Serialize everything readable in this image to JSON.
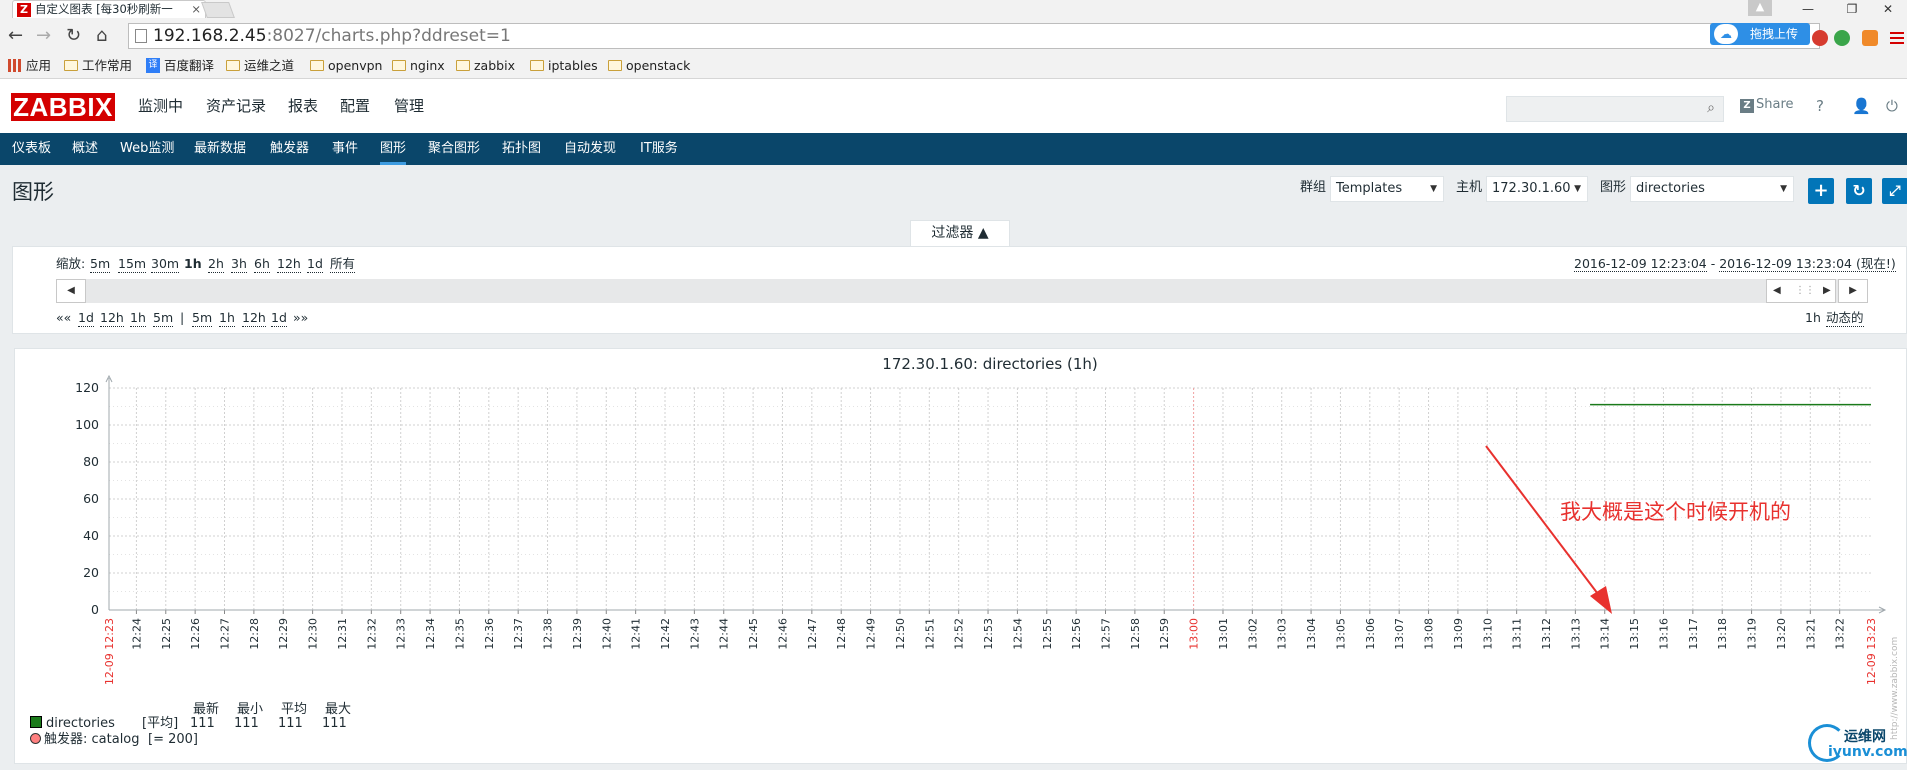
{
  "browser": {
    "tab_title": "自定义图表 [每30秒刷新一",
    "url_host": "192.168.2.45",
    "url_rest": ":8027/charts.php?ddreset=1",
    "upload_label": "拖拽上传",
    "bookmarks": [
      "应用",
      "工作常用",
      "百度翻译",
      "运维之道",
      "openvpn",
      "nginx",
      "zabbix",
      "iptables",
      "openstack"
    ]
  },
  "zabbix": {
    "logo": "ZABBIX",
    "main_menu": [
      "监测中",
      "资产记录",
      "报表",
      "配置",
      "管理"
    ],
    "share_label": "Share",
    "sub_menu": [
      "仪表板",
      "概述",
      "Web监测",
      "最新数据",
      "触发器",
      "事件",
      "图形",
      "聚合图形",
      "拓扑图",
      "自动发现",
      "IT服务"
    ],
    "active_sub": "图形"
  },
  "page": {
    "title": "图形",
    "group_label": "群组",
    "group_value": "Templates",
    "host_label": "主机",
    "host_value": "172.30.1.60",
    "graph_label": "图形",
    "graph_value": "directories"
  },
  "filter": {
    "tab_label": "过滤器 ▲",
    "zoom_label": "缩放:",
    "zoom_options": [
      "5m",
      "15m",
      "30m",
      "1h",
      "2h",
      "3h",
      "6h",
      "12h",
      "1d",
      "所有"
    ],
    "zoom_active": "1h",
    "time_range_from": "2016-12-09 12:23:04",
    "time_range_sep": " - ",
    "time_range_to": "2016-12-09 13:23:04 (现在!)",
    "back_options": [
      "««",
      "1d",
      "12h",
      "1h",
      "5m"
    ],
    "fwd_options": [
      "5m",
      "1h",
      "12h",
      "1d",
      "»»"
    ],
    "period": "1h",
    "dynamic_label": "动态的"
  },
  "colors": {
    "series": "#1a7a1a",
    "trigger": "#ff8080",
    "red_axis": "#e8312e",
    "accent": "#0275b8",
    "nav": "#0a466a"
  },
  "chart_data": {
    "type": "line",
    "title": "172.30.1.60: directories (1h)",
    "ylim": [
      0,
      120
    ],
    "yticks": [
      0,
      20,
      40,
      60,
      80,
      100,
      120
    ],
    "xlabels": [
      "12:24",
      "12:25",
      "12:26",
      "12:27",
      "12:28",
      "12:29",
      "12:30",
      "12:31",
      "12:32",
      "12:33",
      "12:34",
      "12:35",
      "12:36",
      "12:37",
      "12:38",
      "12:39",
      "12:40",
      "12:41",
      "12:42",
      "12:43",
      "12:44",
      "12:45",
      "12:46",
      "12:47",
      "12:48",
      "12:49",
      "12:50",
      "12:51",
      "12:52",
      "12:53",
      "12:54",
      "12:55",
      "12:56",
      "12:57",
      "12:58",
      "12:59",
      "13:00",
      "13:01",
      "13:02",
      "13:03",
      "13:04",
      "13:05",
      "13:06",
      "13:07",
      "13:08",
      "13:09",
      "13:10",
      "13:11",
      "13:12",
      "13:13",
      "13:14",
      "13:15",
      "13:16",
      "13:17",
      "13:18",
      "13:19",
      "13:20",
      "13:21",
      "13:22"
    ],
    "start_label": "12-09 12:23",
    "end_label": "12-09 13:23",
    "highlight_label": "13:00",
    "x_range": [
      "12:23:04",
      "13:23:04"
    ],
    "series": [
      {
        "name": "directories",
        "start": "13:13:30",
        "end": "13:23:04",
        "value": 111
      }
    ],
    "legend": {
      "series_name": "directories",
      "agg": "[平均]",
      "col_headers": [
        "最新",
        "最小",
        "平均",
        "最大"
      ],
      "values": [
        "111",
        "111",
        "111",
        "111"
      ],
      "trigger_text": "触发器: catalog",
      "trigger_cond": "[= 200]"
    },
    "watermark": "http://www.zabbix.com",
    "annotation": "我大概是这个时候开机的"
  },
  "footer": {
    "site_cn": "运维网",
    "site_url": "iyunv.com"
  }
}
